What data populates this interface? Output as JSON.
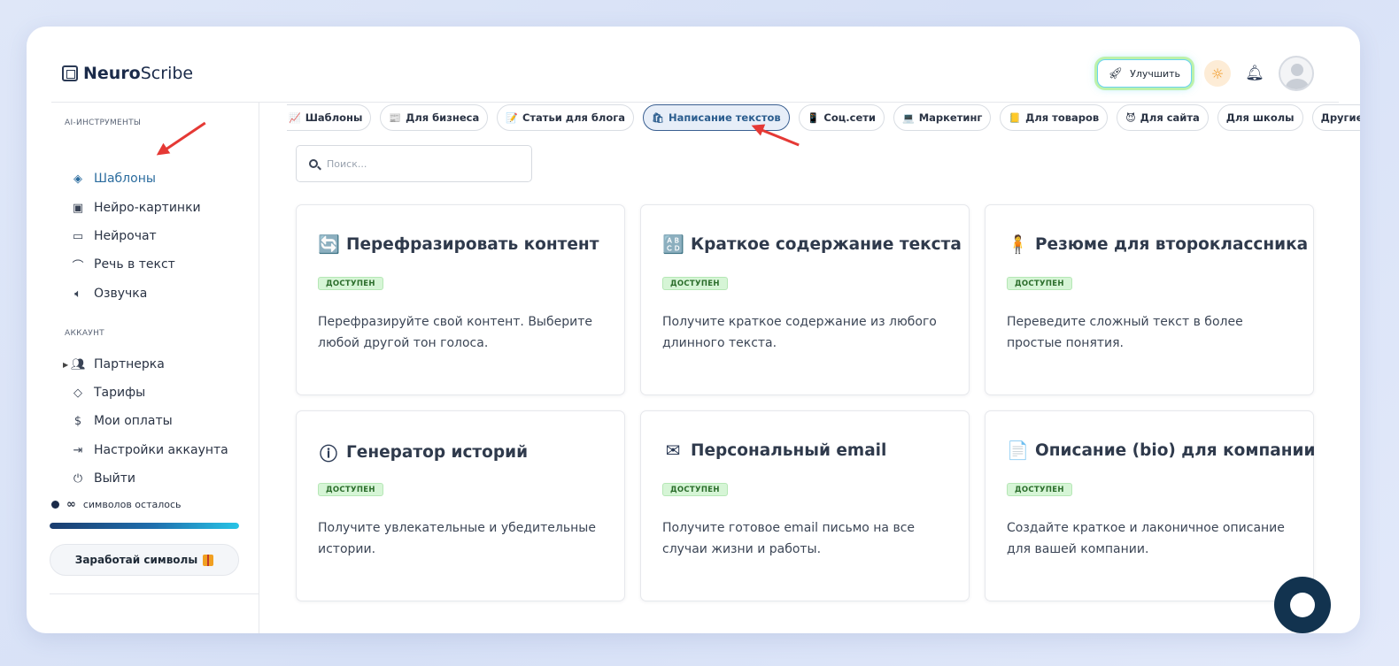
{
  "app": {
    "logo_bold": "Neuro",
    "logo_rest": "Scribe"
  },
  "header": {
    "upgrade_label": "Улучшить",
    "icons": [
      "rocket-icon",
      "sun-icon",
      "bell-icon",
      "avatar"
    ]
  },
  "sidebar": {
    "section_tools": "AI-ИНСТРУМЕНТЫ",
    "tools": [
      {
        "label": "Шаблоны",
        "icon": "layers-icon",
        "active": true
      },
      {
        "label": "Нейро-картинки",
        "icon": "image-icon"
      },
      {
        "label": "Нейрочат",
        "icon": "chat-icon"
      },
      {
        "label": "Речь в текст",
        "icon": "headphones-icon"
      },
      {
        "label": "Озвучка",
        "icon": "speaker-icon"
      }
    ],
    "section_account": "АККАУНТ",
    "account": [
      {
        "label": "Партнерка",
        "icon": "users-icon"
      },
      {
        "label": "Тарифы",
        "icon": "tag-icon"
      },
      {
        "label": "Мои оплаты",
        "icon": "dollar-icon"
      },
      {
        "label": "Настройки аккаунта",
        "icon": "logout-arrow-icon"
      },
      {
        "label": "Выйти",
        "icon": "power-icon"
      }
    ],
    "symbols_infinity": "∞",
    "symbols_label": "символов осталось",
    "symbols_progress": 1.0,
    "earn_label": "Заработай символы"
  },
  "categories": [
    {
      "label": "Шаблоны",
      "emoji": "📈"
    },
    {
      "label": "Для бизнеса",
      "emoji": "📰"
    },
    {
      "label": "Статьи для блога",
      "emoji": "📝"
    },
    {
      "label": "Написание текстов",
      "emoji": "🛍",
      "active": true
    },
    {
      "label": "Соц.сети",
      "emoji": "📱"
    },
    {
      "label": "Маркетинг",
      "emoji": "💻"
    },
    {
      "label": "Для товаров",
      "emoji": "📒"
    },
    {
      "label": "Для сайта",
      "emoji": "😈"
    },
    {
      "label": "Для школы",
      "emoji": ""
    },
    {
      "label": "Другие",
      "emoji": ""
    }
  ],
  "search": {
    "placeholder": "Поиск..."
  },
  "badge_label": "ДОСТУПЕН",
  "cards": [
    {
      "title": "Перефразировать контент",
      "icon": "🔄",
      "desc": "Перефразируйте свой контент. Выберите любой другой тон голоса."
    },
    {
      "title": "Краткое содержание текста",
      "icon": "🔠",
      "desc": "Получите краткое содержание из любого длинного текста."
    },
    {
      "title": "Резюме для второклассника",
      "icon": "🧍",
      "desc": "Переведите сложный текст в более простые понятия."
    },
    {
      "title": "Генератор историй",
      "icon": "ⓘ",
      "desc": "Получите увлекательные и убедительные истории."
    },
    {
      "title": "Персональный email",
      "icon": "✉",
      "desc": "Получите готовое email письмо на все случаи жизни и работы."
    },
    {
      "title": "Описание (bio) для компании",
      "icon": "📄",
      "desc": "Создайте краткое и лаконичное описание для вашей компании."
    }
  ]
}
